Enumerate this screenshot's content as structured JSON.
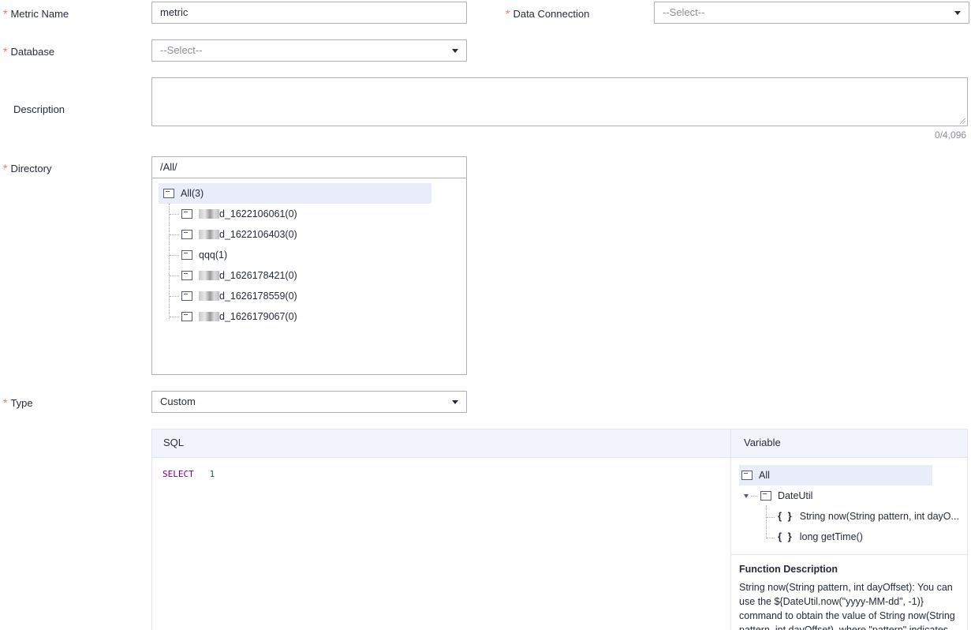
{
  "form": {
    "metric_name": {
      "label": "Metric Name",
      "value": "metric"
    },
    "data_connection": {
      "label": "Data Connection",
      "value": "--Select--"
    },
    "database": {
      "label": "Database",
      "value": "--Select--"
    },
    "description": {
      "label": "Description",
      "counter": "0/4,096"
    },
    "directory": {
      "label": "Directory",
      "path": "/All/",
      "root": "All(3)",
      "items": [
        {
          "suffix": "d_1622106061(0)",
          "masked": true
        },
        {
          "suffix": "d_1622106403(0)",
          "masked": true
        },
        {
          "suffix": "qqq(1)",
          "masked": false
        },
        {
          "suffix": "d_1626178421(0)",
          "masked": true
        },
        {
          "suffix": "d_1626178559(0)",
          "masked": true
        },
        {
          "suffix": "d_1626179067(0)",
          "masked": true
        }
      ]
    },
    "type": {
      "label": "Type",
      "value": "Custom"
    }
  },
  "sql_panel": {
    "header": "SQL",
    "code": {
      "keyword": "SELECT",
      "number": "1"
    }
  },
  "variable_panel": {
    "header": "Variable",
    "root": "All",
    "group": "DateUtil",
    "functions": [
      {
        "icon": "{ }",
        "label": "String now(String pattern, int dayO..."
      },
      {
        "icon": "{ }",
        "label": "long getTime()"
      }
    ],
    "function_description": {
      "title": "Function Description",
      "lines": [
        "String now(String pattern, int dayOffset): You can",
        "use the ${DateUtil.now(\"yyyy-MM-dd\", -1)}",
        "command to obtain the value of String now(String",
        "pattern, int dayOffset), where \"pattern\" indicates"
      ]
    }
  },
  "colors": {
    "required": "#f66f6a",
    "selected_row": "#e9edfa",
    "panel_header": "#f1f4fd"
  }
}
